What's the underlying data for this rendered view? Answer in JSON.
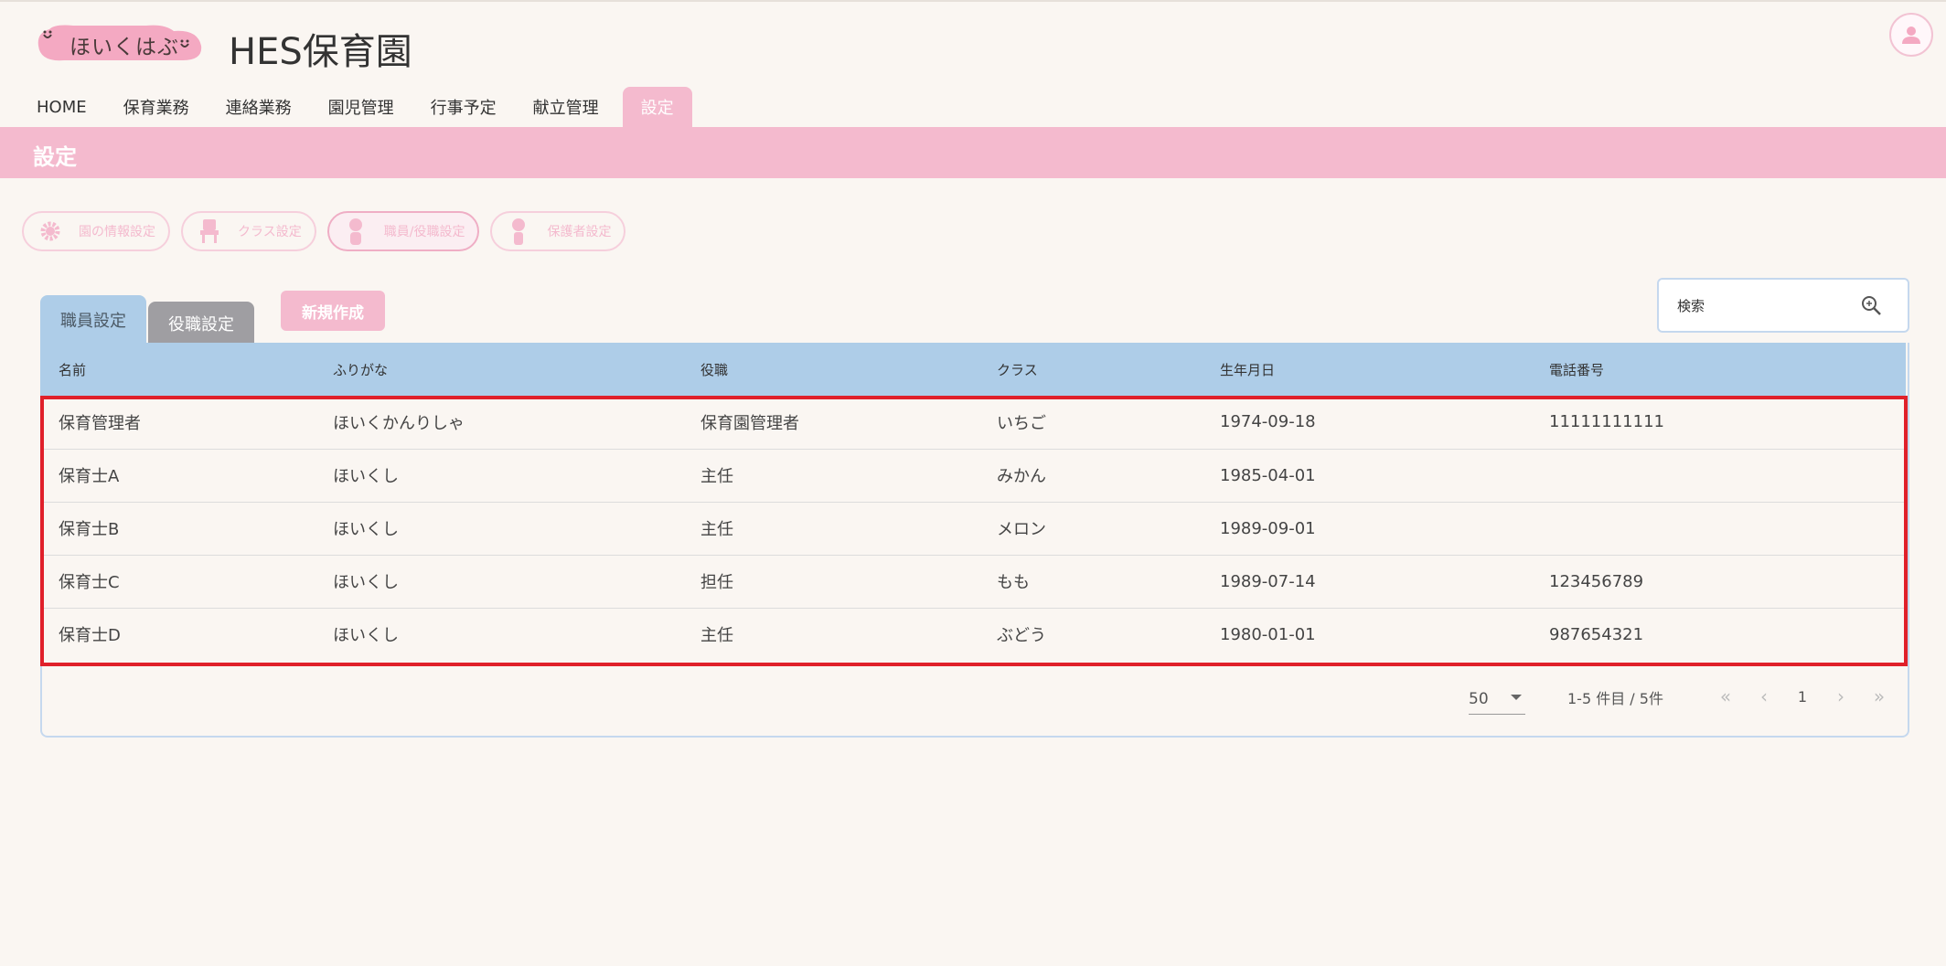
{
  "header": {
    "logo_text": "ほいくはぶ",
    "site_title": "HES保育園"
  },
  "nav": {
    "items": [
      "HOME",
      "保育業務",
      "連絡業務",
      "園児管理",
      "行事予定",
      "献立管理",
      "設定"
    ],
    "active": "設定"
  },
  "section_title": "設定",
  "submenu": {
    "items": [
      {
        "label": "園の情報設定",
        "icon": "gear-icon"
      },
      {
        "label": "クラス設定",
        "icon": "chair-icon"
      },
      {
        "label": "職員/役職設定",
        "icon": "staff-icon"
      },
      {
        "label": "保護者設定",
        "icon": "guardian-icon"
      }
    ],
    "active": "職員/役職設定"
  },
  "tabs": {
    "staff": "職員設定",
    "role": "役職設定"
  },
  "new_button": "新規作成",
  "search": {
    "placeholder": "検索"
  },
  "table": {
    "headers": [
      "名前",
      "ふりがな",
      "役職",
      "クラス",
      "生年月日",
      "電話番号"
    ],
    "rows": [
      [
        "保育管理者",
        "ほいくかんりしゃ",
        "保育園管理者",
        "いちご",
        "1974-09-18",
        "11111111111"
      ],
      [
        "保育士A",
        "ほいくし",
        "主任",
        "みかん",
        "1985-04-01",
        ""
      ],
      [
        "保育士B",
        "ほいくし",
        "主任",
        "メロン",
        "1989-09-01",
        ""
      ],
      [
        "保育士C",
        "ほいくし",
        "担任",
        "もも",
        "1989-07-14",
        "123456789"
      ],
      [
        "保育士D",
        "ほいくし",
        "主任",
        "ぶどう",
        "1980-01-01",
        "987654321"
      ]
    ]
  },
  "pagination": {
    "per_page": "50",
    "range": "1-5 件目 / 5件",
    "current_page": "1"
  },
  "colors": {
    "brand_pink": "#f4bace",
    "table_header_blue": "#aecde8",
    "highlight_red": "#e0202a"
  }
}
